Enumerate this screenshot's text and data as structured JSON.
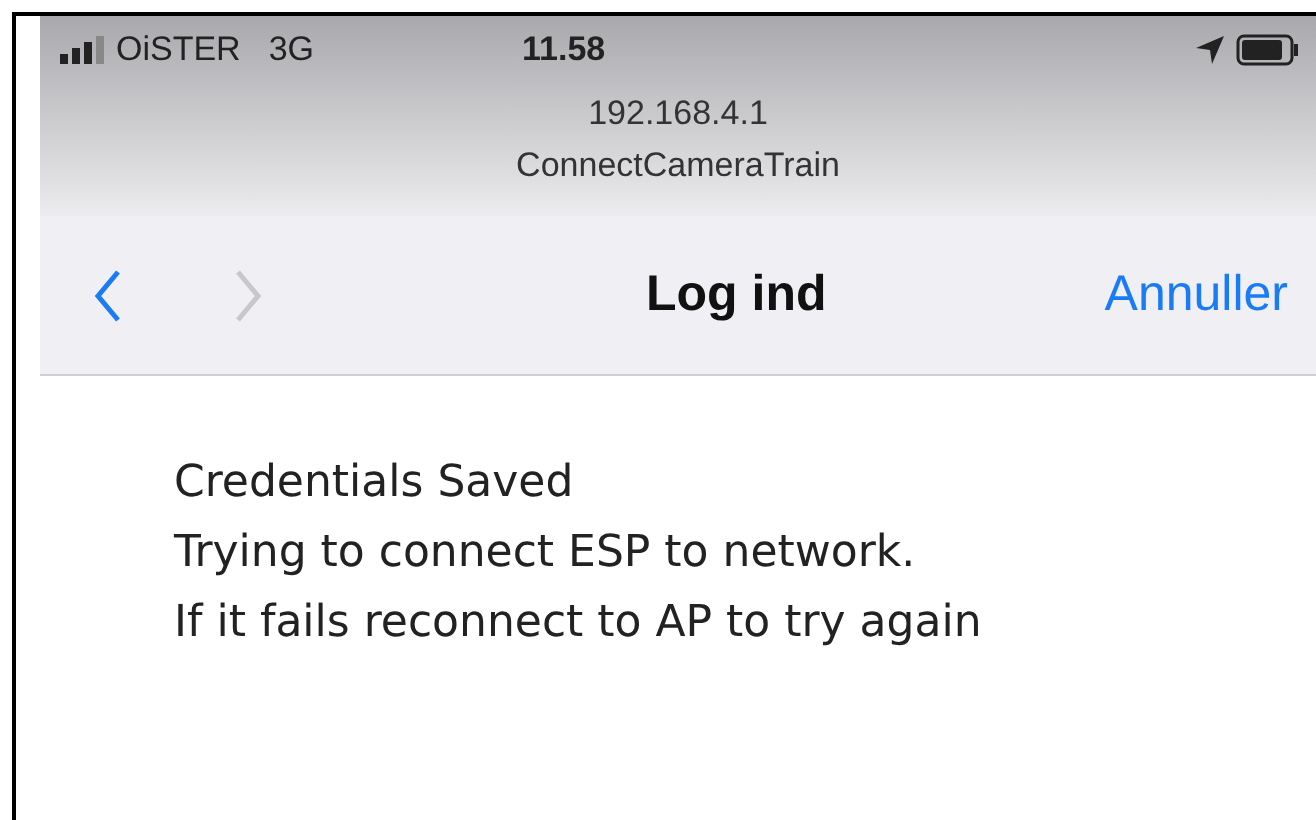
{
  "status_bar": {
    "carrier": "OiSTER",
    "network": "3G",
    "time": "11.58"
  },
  "address": {
    "host": "192.168.4.1",
    "network_name": "ConnectCameraTrain"
  },
  "nav_bar": {
    "back": {
      "disabled": false
    },
    "forward": {
      "disabled": true
    },
    "title": "Log ind",
    "cancel": "Annuller"
  },
  "content": {
    "lines": [
      "Credentials Saved",
      "Trying to connect ESP to network.",
      "If it fails reconnect to AP to try again"
    ]
  }
}
